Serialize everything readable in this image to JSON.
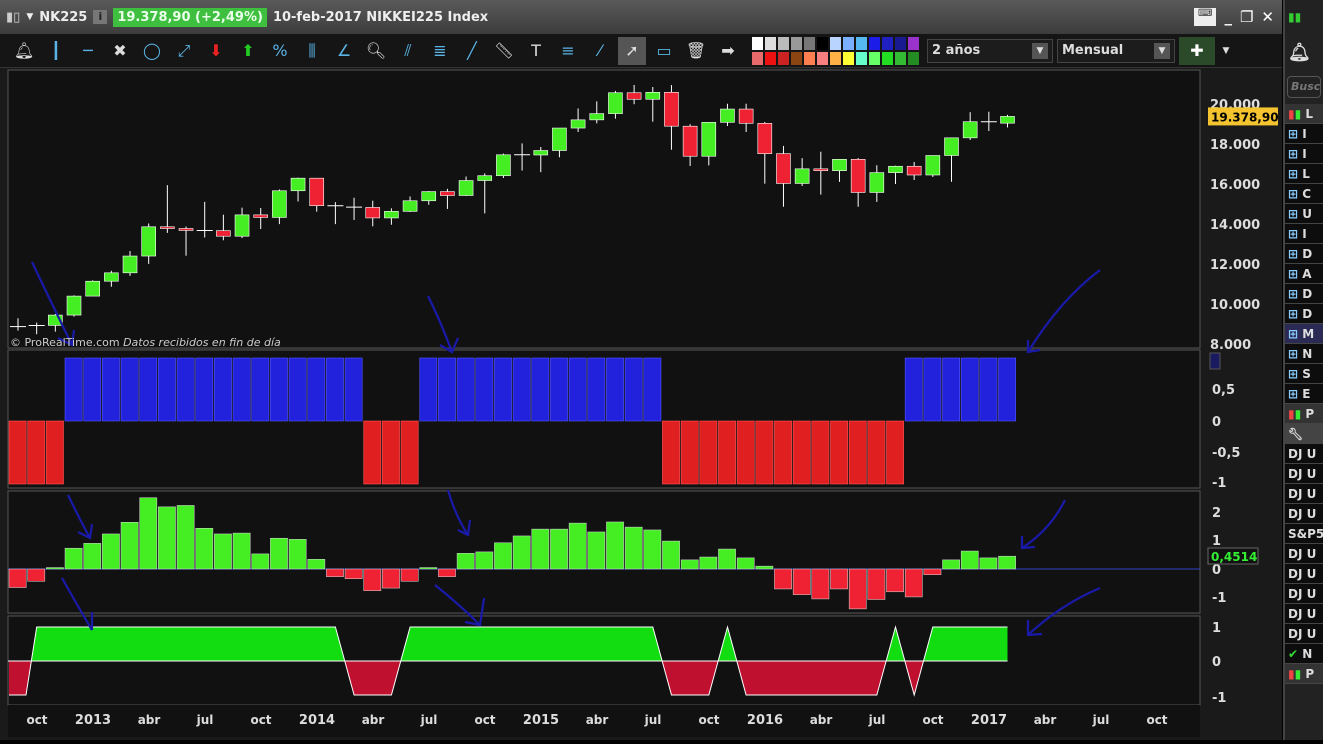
{
  "header": {
    "symbol": "NK225",
    "info": "i",
    "price": "19.378,90 (+2,49%)",
    "date_desc": "10-feb-2017 NIKKEI225 Index"
  },
  "window_buttons": [
    "keyboard-icon",
    "minimize-icon",
    "restore-icon",
    "close-icon"
  ],
  "toolbar": {
    "tools": [
      "bell-icon",
      "vertical-line-icon",
      "horizontal-line-icon",
      "tools-icon",
      "ellipse-icon",
      "segment-icon",
      "arrow-down-icon",
      "arrow-up-icon",
      "percent-icon",
      "fan-lines-icon",
      "angle-icon",
      "zoom-icon",
      "parallel-channel-icon",
      "fibonacci-icon",
      "trendline-icon",
      "ruler-icon",
      "text-icon",
      "fibonacci-fan-icon",
      "line-tool-icon",
      "cursor-icon",
      "rectangle-icon",
      "trash-icon",
      "arrow-right-icon"
    ],
    "swatches_top": [
      "#ffffff",
      "#dddddd",
      "#bbbbbb",
      "#999999",
      "#777777",
      "#000000",
      "#b8d4ff",
      "#7ab0ff",
      "#55b8f0",
      "#1c1ce8",
      "#2020c0",
      "#1a1a90",
      "#9933cc",
      "#ff88cc"
    ],
    "swatches_bottom": [
      "#e86a6a",
      "#ee1111",
      "#cc2222",
      "#8b4513",
      "#ff7f50",
      "#fa8080",
      "#ffb347",
      "#ffff33",
      "#66ffcc",
      "#66ff66",
      "#22dd22",
      "#33bb33",
      "#228b22"
    ],
    "period": "2 años",
    "timeframe": "Mensual"
  },
  "chart": {
    "current_price": "19.378,90",
    "watermark_brand": "© ProRealTime.com",
    "watermark_note": "Datos recibidos en fin de día",
    "price_ticks": [
      "20.000",
      "18.000",
      "16.000",
      "14.000",
      "12.000",
      "10.000",
      "8.000"
    ],
    "panel2_ticks": [
      "0,5",
      "0",
      "-0,5",
      "-1"
    ],
    "panel2_marker": "1",
    "panel3_ticks": [
      "2",
      "1",
      "0",
      "-1"
    ],
    "panel3_value": "0,4514",
    "panel4_ticks": [
      "1",
      "0",
      "-1"
    ],
    "x_labels": [
      "oct",
      "2013",
      "abr",
      "jul",
      "oct",
      "2014",
      "abr",
      "jul",
      "oct",
      "2015",
      "abr",
      "jul",
      "oct",
      "2016",
      "abr",
      "jul",
      "oct",
      "2017",
      "abr",
      "jul",
      "oct"
    ],
    "colors": {
      "up": "#44ee22",
      "down": "#ee2233",
      "blue": "#2222dd"
    }
  },
  "chart_data": {
    "type": "candlestick",
    "start": "2012-09",
    "frequency": "monthly",
    "ohlc": [
      [
        8840,
        9288,
        8668,
        8870
      ],
      [
        8870,
        9070,
        8488,
        8928
      ],
      [
        8928,
        9500,
        8619,
        9446
      ],
      [
        9446,
        10433,
        9368,
        10395
      ],
      [
        10395,
        11185,
        10398,
        11139
      ],
      [
        11139,
        11662,
        10863,
        11559
      ],
      [
        11559,
        12650,
        11404,
        12398
      ],
      [
        12398,
        14027,
        12004,
        13861
      ],
      [
        13861,
        15942,
        13555,
        13775
      ],
      [
        13775,
        13874,
        12415,
        13677
      ],
      [
        13677,
        15108,
        13325,
        13668
      ],
      [
        13668,
        14466,
        13188,
        13389
      ],
      [
        13389,
        14817,
        13293,
        14456
      ],
      [
        14456,
        14799,
        13748,
        14328
      ],
      [
        14328,
        15727,
        13995,
        15662
      ],
      [
        15662,
        16320,
        15126,
        16291
      ],
      [
        16291,
        16164,
        14619,
        14915
      ],
      [
        14915,
        15094,
        13995,
        14841
      ],
      [
        14841,
        15312,
        14203,
        14828
      ],
      [
        14828,
        15164,
        13885,
        14304
      ],
      [
        14304,
        14784,
        13964,
        14632
      ],
      [
        14632,
        15376,
        14600,
        15162
      ],
      [
        15162,
        15646,
        14964,
        15621
      ],
      [
        15621,
        15759,
        14753,
        15425
      ],
      [
        15425,
        16374,
        15400,
        16174
      ],
      [
        16174,
        16533,
        14529,
        16414
      ],
      [
        16414,
        17520,
        16300,
        17460
      ],
      [
        17460,
        18030,
        16672,
        17450
      ],
      [
        17450,
        17850,
        16592,
        17674
      ],
      [
        17674,
        18800,
        17336,
        18798
      ],
      [
        18798,
        19778,
        18600,
        19207
      ],
      [
        19207,
        20133,
        19034,
        19520
      ],
      [
        19520,
        20655,
        19267,
        20563
      ],
      [
        20563,
        20952,
        19990,
        20236
      ],
      [
        20236,
        20850,
        19115,
        20585
      ],
      [
        20585,
        20946,
        17714,
        18890
      ],
      [
        18890,
        18990,
        16901,
        17388
      ],
      [
        17388,
        19100,
        16930,
        19083
      ],
      [
        19083,
        20012,
        18900,
        19747
      ],
      [
        19747,
        20013,
        18600,
        19034
      ],
      [
        19034,
        19100,
        16017,
        17518
      ],
      [
        17518,
        17905,
        14865,
        16027
      ],
      [
        16027,
        17291,
        15900,
        16759
      ],
      [
        16759,
        17613,
        15471,
        16666
      ],
      [
        16666,
        17251,
        16106,
        17235
      ],
      [
        17235,
        17300,
        14864,
        15576
      ],
      [
        15576,
        16938,
        15106,
        16569
      ],
      [
        16569,
        16919,
        16000,
        16887
      ],
      [
        16887,
        17100,
        16200,
        16450
      ],
      [
        16450,
        17425,
        16350,
        17425
      ],
      [
        17425,
        18225,
        16111,
        18308
      ],
      [
        18308,
        19592,
        18200,
        19114
      ],
      [
        19114,
        19615,
        18650,
        19041
      ],
      [
        19041,
        19459,
        18828,
        19378.9
      ]
    ],
    "signal": [
      -1,
      -1,
      -1,
      1,
      1,
      1,
      1,
      1,
      1,
      1,
      1,
      1,
      1,
      1,
      1,
      1,
      1,
      1,
      1,
      -1,
      -1,
      -1,
      1,
      1,
      1,
      1,
      1,
      1,
      1,
      1,
      1,
      1,
      1,
      1,
      1,
      -1,
      -1,
      -1,
      -1,
      -1,
      -1,
      -1,
      -1,
      -1,
      -1,
      -1,
      -1,
      -1,
      1,
      1,
      1,
      1,
      1,
      1
    ],
    "histogram": [
      -0.65,
      -0.43,
      0.05,
      0.73,
      0.9,
      1.23,
      1.64,
      2.5,
      2.18,
      2.23,
      1.43,
      1.23,
      1.26,
      0.53,
      1.08,
      1.04,
      0.34,
      -0.27,
      -0.34,
      -0.76,
      -0.67,
      -0.43,
      0.05,
      -0.27,
      0.55,
      0.6,
      0.92,
      1.16,
      1.4,
      1.4,
      1.61,
      1.3,
      1.65,
      1.47,
      1.37,
      0.98,
      0.32,
      0.42,
      0.7,
      0.39,
      0.1,
      -0.7,
      -0.9,
      -1.05,
      -0.7,
      -1.4,
      -1.07,
      -0.8,
      -0.98,
      -0.2,
      0.32,
      0.63,
      0.39,
      0.45
    ],
    "oscillator": [
      -1,
      1,
      1,
      1,
      1,
      1,
      1,
      1,
      1,
      1,
      1,
      1,
      1,
      1,
      1,
      1,
      1,
      1,
      -1,
      -1,
      -1,
      1,
      1,
      1,
      1,
      1,
      1,
      1,
      1,
      1,
      1,
      1,
      1,
      1,
      1,
      -1,
      -1,
      -1,
      1,
      -1,
      -1,
      -1,
      -1,
      -1,
      -1,
      -1,
      -1,
      1,
      -1,
      1,
      1,
      1,
      1,
      1
    ],
    "price_range": [
      8000,
      20000
    ],
    "histogram_range": [
      -1.5,
      2.5
    ],
    "signal_range": [
      -1,
      1
    ]
  },
  "sidebar": {
    "search_placeholder": "Busc",
    "list_title": "L",
    "items": [
      "I",
      "I",
      "L",
      "C",
      "U",
      "I",
      "D",
      "A",
      "D",
      "D",
      "M",
      "N",
      "S",
      "E"
    ],
    "panel2_title": "P",
    "rows": [
      "DJ U",
      "DJ U",
      "DJ U",
      "DJ U",
      "S&P5",
      "DJ U",
      "DJ U",
      "DJ U",
      "DJ U",
      "DJ U",
      "N"
    ],
    "panel3_title": "P"
  }
}
